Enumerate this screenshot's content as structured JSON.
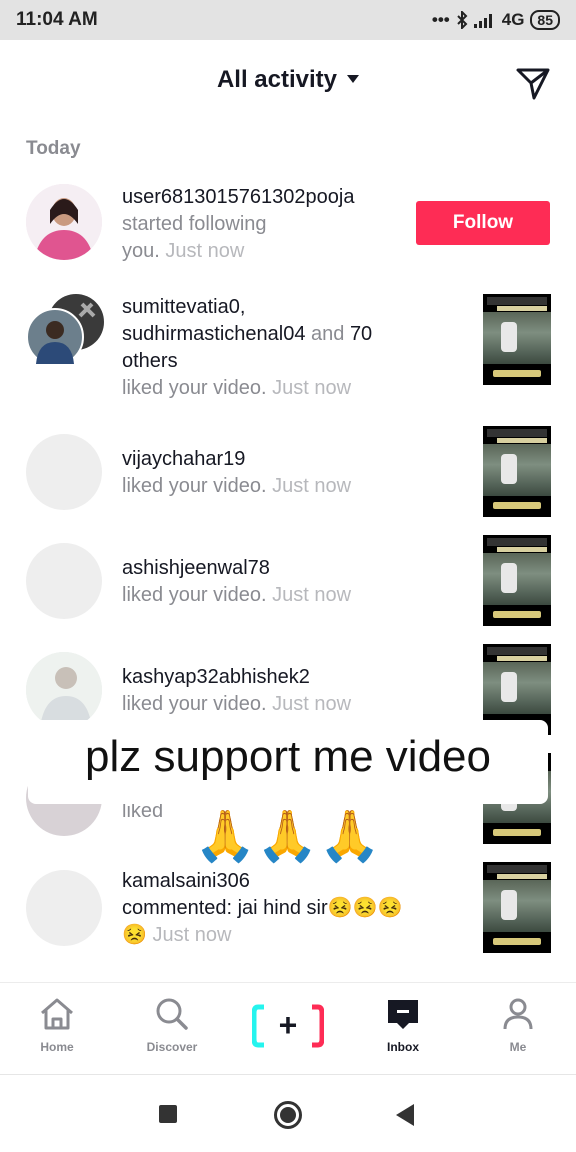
{
  "status_bar": {
    "time": "11:04 AM",
    "network": "4G",
    "battery": "85"
  },
  "header": {
    "title": "All activity"
  },
  "section": {
    "today": "Today"
  },
  "activities": [
    {
      "user": "user6813015761302pooja",
      "action_line1": "started following",
      "action_line2": "you.",
      "time": "Just now",
      "button": "Follow"
    },
    {
      "users_line1": "sumittevatia0,",
      "users_line2": "sudhirmastichenal04",
      "and_text": "and",
      "count": "70",
      "others": "others",
      "action": "liked your video.",
      "time": "Just now"
    },
    {
      "user": "vijaychahar19",
      "action": "liked your video.",
      "time": "Just now"
    },
    {
      "user": "ashishjeenwal78",
      "action": "liked your video.",
      "time": "Just now"
    },
    {
      "user": "kashyap32abhishek2",
      "action": "liked your video.",
      "time": "Just now"
    },
    {
      "action": "liked"
    },
    {
      "user": "kamalsaini306",
      "action": "commented: jai hind sir😣😣😣",
      "emoji": "😣",
      "time": "Just now"
    }
  ],
  "overlay": {
    "caption": "plz support me video",
    "emojis": "🙏🙏🙏"
  },
  "nav": {
    "home": "Home",
    "discover": "Discover",
    "create": "+",
    "inbox": "Inbox",
    "me": "Me"
  },
  "colors": {
    "accent": "#fe2c55",
    "cyan": "#25f4ee"
  }
}
